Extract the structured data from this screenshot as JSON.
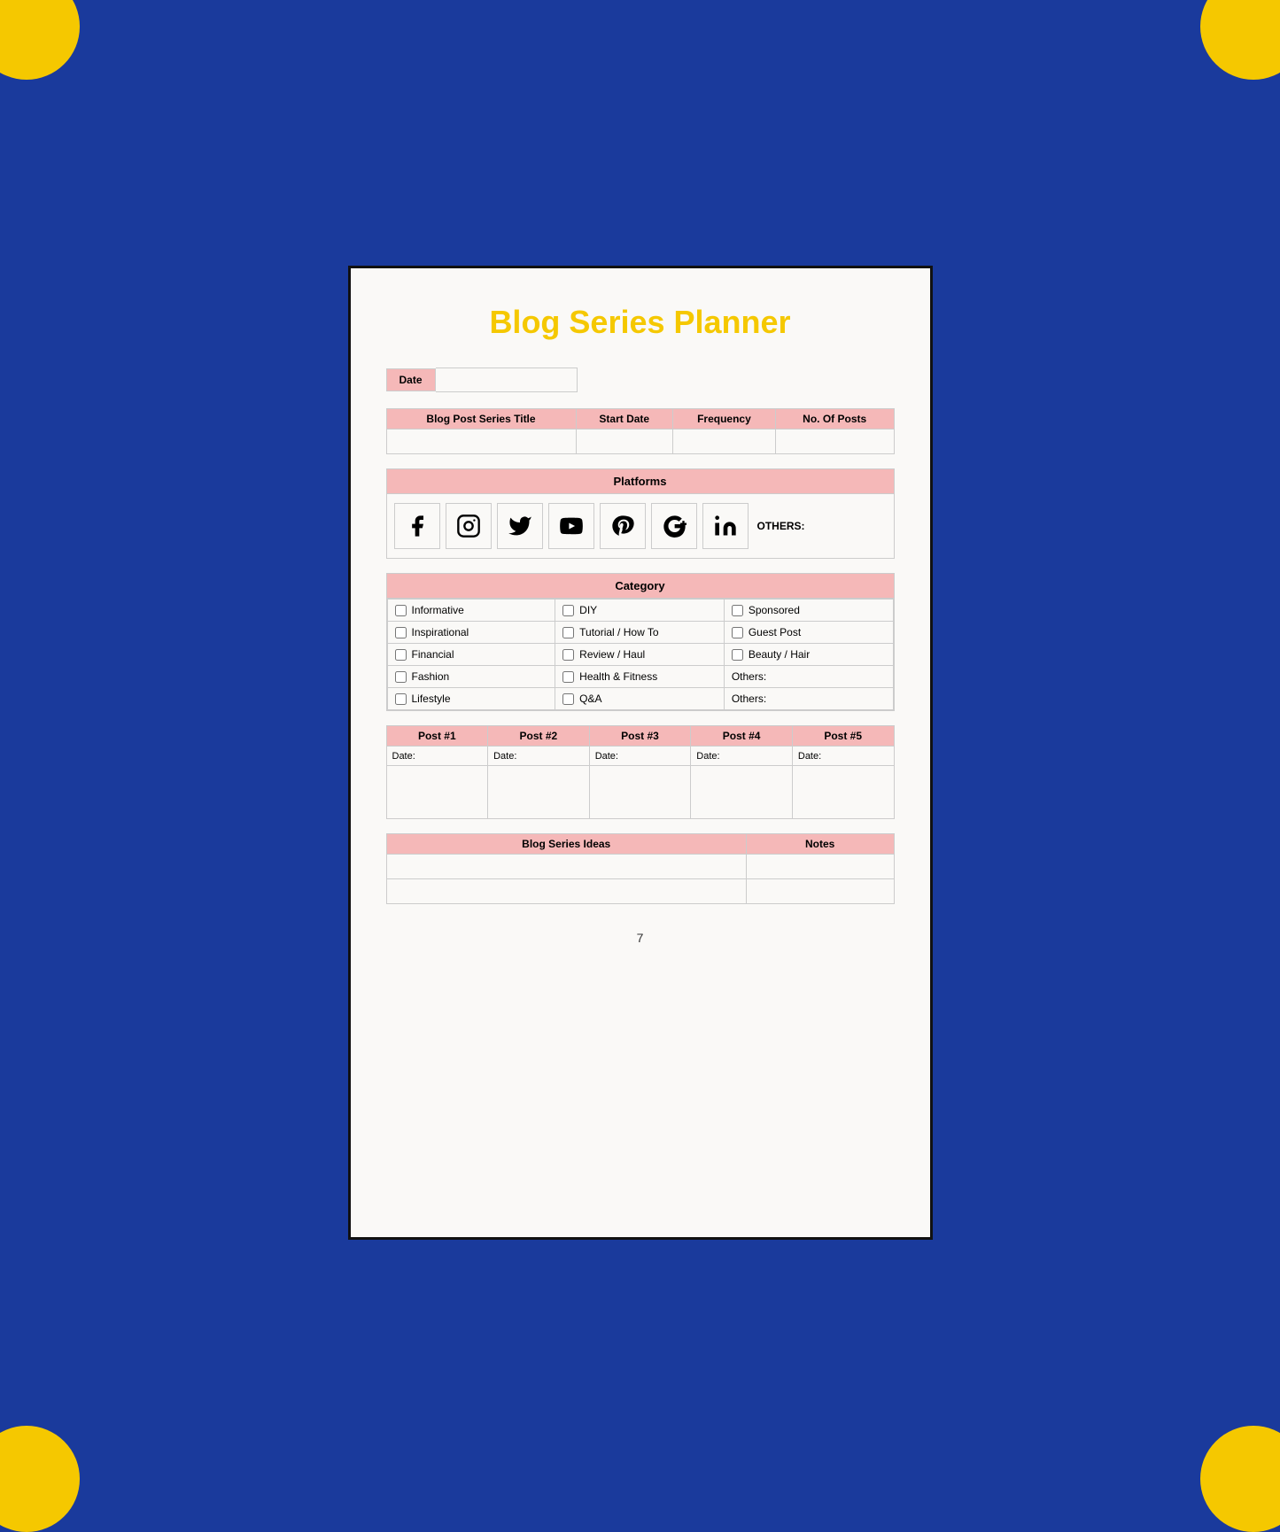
{
  "background_color": "#1a3a9c",
  "corner_color": "#f5c800",
  "page": {
    "title": "Blog Series Planner",
    "title_color": "#f5c800",
    "date_label": "Date",
    "date_value": "",
    "series_table": {
      "headers": [
        "Blog Post Series Title",
        "Start Date",
        "Frequency",
        "No. Of Posts"
      ]
    },
    "platforms": {
      "label": "Platforms",
      "icons": [
        "f",
        "instagram",
        "twitter",
        "youtube",
        "pinterest",
        "google+",
        "linkedin"
      ],
      "others_label": "OTHERS:"
    },
    "category": {
      "label": "Category",
      "items_col1": [
        "Informative",
        "Inspirational",
        "Financial",
        "Fashion",
        "Lifestyle"
      ],
      "items_col2": [
        "DIY",
        "Tutorial / How To",
        "Review / Haul",
        "Health & Fitness",
        "Q&A"
      ],
      "items_col3_check": [
        "Sponsored",
        "Guest Post",
        "Beauty / Hair"
      ],
      "items_col3_text": [
        "Others:",
        "Others:"
      ]
    },
    "posts": {
      "headers": [
        "Post #1",
        "Post #2",
        "Post #3",
        "Post #4",
        "Post #5"
      ],
      "date_label": "Date:"
    },
    "bottom_table": {
      "headers": [
        "Blog Series Ideas",
        "Notes"
      ]
    },
    "page_number": "7"
  }
}
